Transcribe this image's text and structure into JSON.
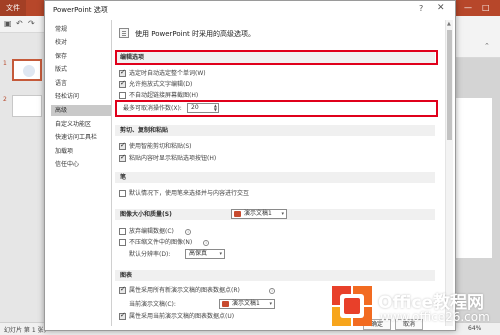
{
  "background": {
    "file_tab": "文件",
    "slide_numbers": [
      "1",
      "2"
    ],
    "status_left": "幻灯片 第 1 张，",
    "zoom": "64%"
  },
  "dialog": {
    "title": "PowerPoint 选项",
    "help": "?",
    "close": "✕",
    "nav": [
      "常规",
      "校对",
      "保存",
      "版式",
      "语言",
      "轻松访问",
      "高级",
      "自定义功能区",
      "快速访问工具栏",
      "加载项",
      "信任中心"
    ],
    "selected_nav": "高级",
    "intro": "使用 PowerPoint 时采用的高级选项。",
    "sections": {
      "editing": {
        "title": "编辑选项",
        "options": [
          "选定时自动选定整个单词(W)",
          "允许拖放式文字编辑(D)",
          "不自动超链接屏幕截图(H)"
        ],
        "checked": [
          true,
          true,
          false
        ],
        "undo_label": "最多可取消操作数(X):",
        "undo_value": "20"
      },
      "clipboard": {
        "title": "剪切、复制和粘贴",
        "options": [
          "使用智能剪切和粘贴(S)",
          "粘贴内容时显示粘贴选项按钮(H)"
        ],
        "checked": [
          true,
          true
        ]
      },
      "pen": {
        "title": "笔",
        "options": [
          "默认情况下，使用笔来选择并与内容进行交互"
        ],
        "checked": [
          false
        ]
      },
      "image": {
        "title": "图像大小和质量(S)",
        "doc": "演示文稿1",
        "options": [
          "放弃编辑数据(C)",
          "不压缩文件中的图像(N)"
        ],
        "checked": [
          false,
          false
        ],
        "resolution_label": "默认分辨率(D):",
        "resolution_value": "高保真"
      },
      "chart": {
        "title": "图表",
        "options": [
          "属性采用所有新演示文稿的图表数据点(R)",
          "属性采用当前演示文稿的图表数据点(U)"
        ],
        "checked": [
          true,
          true
        ],
        "current_label": "当前演示文稿(C):",
        "current_doc": "演示文稿1"
      }
    },
    "buttons": {
      "ok": "确定",
      "cancel": "取消"
    }
  },
  "watermark": {
    "brand": "Office教程网",
    "url": "www.office26.com"
  },
  "colors": {
    "accent": "#b7472a",
    "highlight": "#e0001b",
    "logo_orange": "#f26b21",
    "logo_red": "#e8402a",
    "logo_yellow": "#f7a51c"
  }
}
